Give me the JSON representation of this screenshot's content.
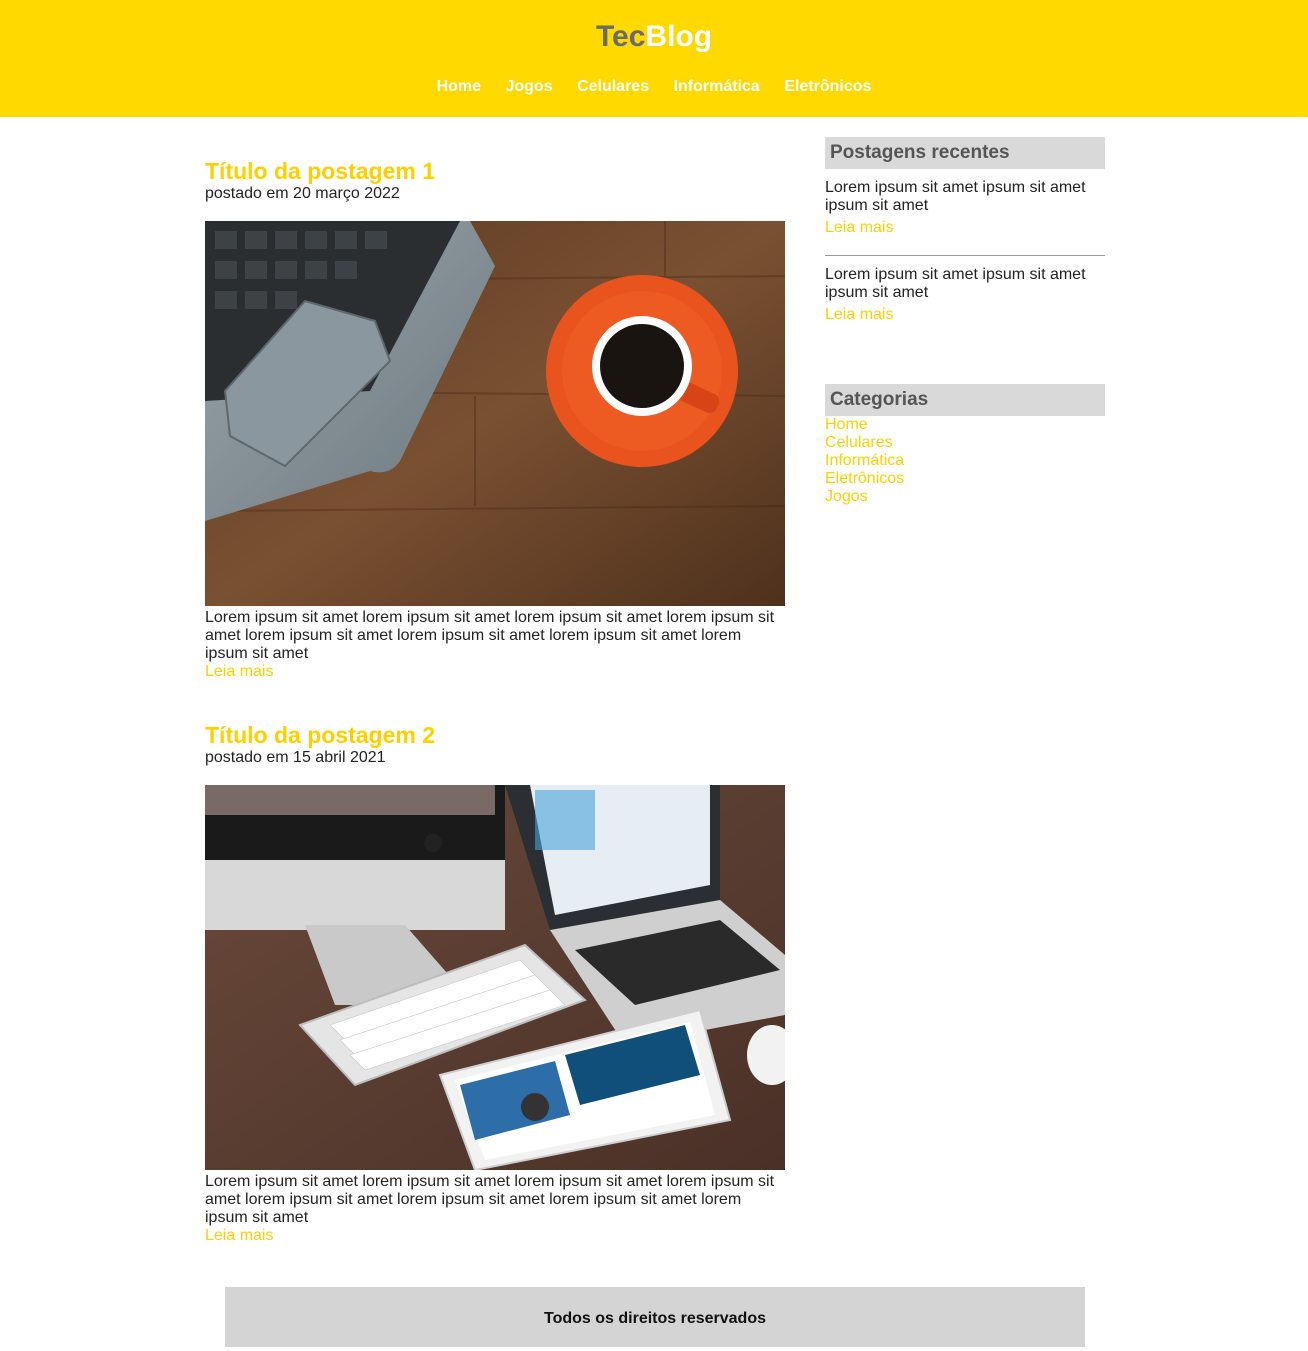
{
  "header": {
    "logo_part1": "Tec",
    "logo_part2": "Blog",
    "nav": [
      "Home",
      "Jogos",
      "Celulares",
      "Informática",
      "Eletrônicos"
    ]
  },
  "posts": [
    {
      "title": "Título da postagem 1",
      "date": "postado em 20 março 2022",
      "image": "laptop-and-coffee-photo",
      "excerpt": "Lorem ipsum sit amet lorem ipsum sit amet lorem ipsum sit amet lorem ipsum sit amet lorem ipsum sit amet lorem ipsum sit amet lorem ipsum sit amet lorem ipsum sit amet",
      "read_more": "Leia mais"
    },
    {
      "title": "Título da postagem 2",
      "date": "postado em 15 abril 2021",
      "image": "apple-devices-desk-photo",
      "excerpt": "Lorem ipsum sit amet lorem ipsum sit amet lorem ipsum sit amet lorem ipsum sit amet lorem ipsum sit amet lorem ipsum sit amet lorem ipsum sit amet lorem ipsum sit amet",
      "read_more": "Leia mais"
    }
  ],
  "sidebar": {
    "recent_title": "Postagens recentes",
    "recent": [
      {
        "text": "Lorem ipsum sit amet ipsum sit amet ipsum sit amet",
        "read_more": "Leia mais"
      },
      {
        "text": "Lorem ipsum sit amet ipsum sit amet ipsum sit amet",
        "read_more": "Leia mais"
      }
    ],
    "categories_title": "Categorias",
    "categories": [
      "Home",
      "Celulares",
      "Informática",
      "Eletrônicos",
      "Jogos"
    ]
  },
  "footer": {
    "text": "Todos os direitos reservados"
  },
  "colors": {
    "brand_yellow": "#FFD900",
    "link_yellow": "#FFD000",
    "sidebar_gray": "#d9d9d9",
    "footer_gray": "#d4d4d4"
  }
}
